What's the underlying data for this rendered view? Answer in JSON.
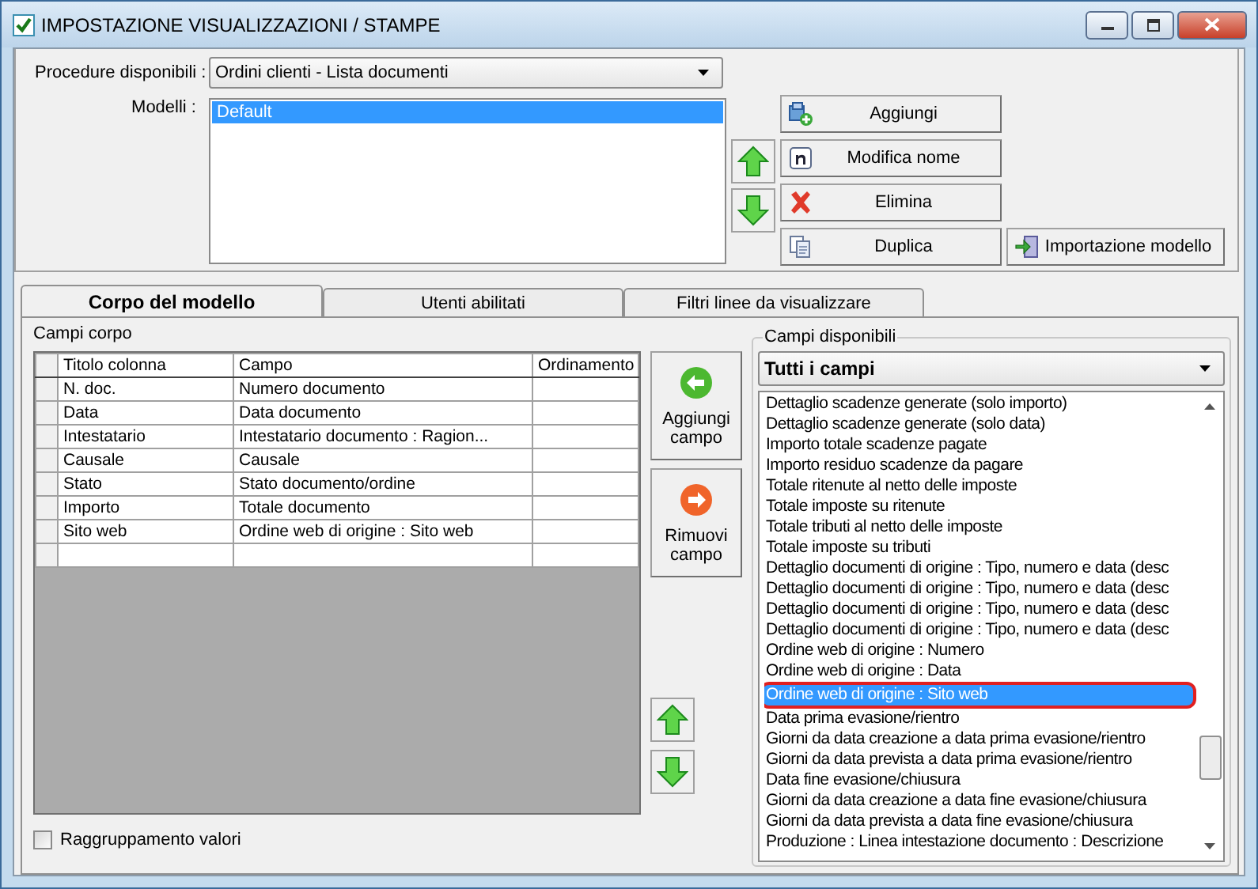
{
  "window": {
    "title": "IMPOSTAZIONE VISUALIZZAZIONI / STAMPE"
  },
  "procedure": {
    "label": "Procedure disponibili :",
    "value": "Ordini clienti - Lista documenti"
  },
  "models": {
    "label": "Modelli :",
    "items": [
      {
        "text": "Default",
        "selected": true
      }
    ]
  },
  "model_buttons": [
    {
      "label": "Aggiungi",
      "kind": "add"
    },
    {
      "label": "Modifica nome",
      "kind": "rename"
    },
    {
      "label": "Elimina",
      "kind": "delete"
    },
    {
      "label": "Duplica",
      "kind": "duplicate"
    },
    {
      "label": "Importazione modello",
      "kind": "import"
    }
  ],
  "tabs": [
    {
      "label": "Corpo del modello",
      "selected": true
    },
    {
      "label": "Utenti abilitati",
      "selected": false
    },
    {
      "label": "Filtri linee da visualizzare",
      "selected": false
    }
  ],
  "body_fields": {
    "label": "Campi corpo",
    "columns": [
      "Titolo colonna",
      "Campo",
      "Ordinamento"
    ],
    "rows": [
      [
        "N. doc.",
        "Numero documento"
      ],
      [
        "Data",
        "Data documento"
      ],
      [
        "Intestatario",
        "Intestatario documento : Ragion..."
      ],
      [
        "Causale",
        "Causale"
      ],
      [
        "Stato",
        "Stato documento/ordine"
      ],
      [
        "Importo",
        "Totale documento"
      ],
      [
        "Sito web",
        "Ordine web di origine : Sito web"
      ]
    ]
  },
  "field_buttons": [
    {
      "label": "Aggiungi campo",
      "kind": "add"
    },
    {
      "label": "Rimuovi campo",
      "kind": "remove"
    }
  ],
  "grouping": {
    "label": "Raggruppamento valori",
    "checked": false
  },
  "available": {
    "label": "Campi disponibili",
    "filter": "Tutti i campi",
    "items": [
      {
        "text": "Dettaglio scadenze generate (solo importo)",
        "selected": false,
        "circled": false
      },
      {
        "text": "Dettaglio scadenze generate (solo data)",
        "selected": false,
        "circled": false
      },
      {
        "text": "Importo totale scadenze pagate",
        "selected": false,
        "circled": false
      },
      {
        "text": "Importo residuo scadenze da pagare",
        "selected": false,
        "circled": false
      },
      {
        "text": "Totale ritenute al netto delle imposte",
        "selected": false,
        "circled": false
      },
      {
        "text": "Totale imposte su ritenute",
        "selected": false,
        "circled": false
      },
      {
        "text": "Totale tributi al netto delle imposte",
        "selected": false,
        "circled": false
      },
      {
        "text": "Totale imposte su tributi",
        "selected": false,
        "circled": false
      },
      {
        "text": "Dettaglio documenti di origine : Tipo, numero e data (desc",
        "selected": false,
        "circled": false
      },
      {
        "text": "Dettaglio documenti di origine : Tipo, numero e data (desc",
        "selected": false,
        "circled": false
      },
      {
        "text": "Dettaglio documenti di origine : Tipo, numero e data (desc",
        "selected": false,
        "circled": false
      },
      {
        "text": "Dettaglio documenti di origine : Tipo, numero e data (desc",
        "selected": false,
        "circled": false
      },
      {
        "text": "Ordine web di origine : Numero",
        "selected": false,
        "circled": false
      },
      {
        "text": "Ordine web di origine : Data",
        "selected": false,
        "circled": false
      },
      {
        "text": "Ordine web di origine : Sito web",
        "selected": true,
        "circled": true
      },
      {
        "text": "Data prima evasione/rientro",
        "selected": false,
        "circled": false
      },
      {
        "text": "Giorni da data creazione a data prima evasione/rientro",
        "selected": false,
        "circled": false
      },
      {
        "text": "Giorni da data prevista a data prima evasione/rientro",
        "selected": false,
        "circled": false
      },
      {
        "text": "Data fine evasione/chiusura",
        "selected": false,
        "circled": false
      },
      {
        "text": "Giorni da data creazione a data fine evasione/chiusura",
        "selected": false,
        "circled": false
      },
      {
        "text": "Giorni da data prevista a data fine evasione/chiusura",
        "selected": false,
        "circled": false
      },
      {
        "text": "Produzione : Linea intestazione documento : Descrizione",
        "selected": false,
        "circled": false
      }
    ]
  }
}
